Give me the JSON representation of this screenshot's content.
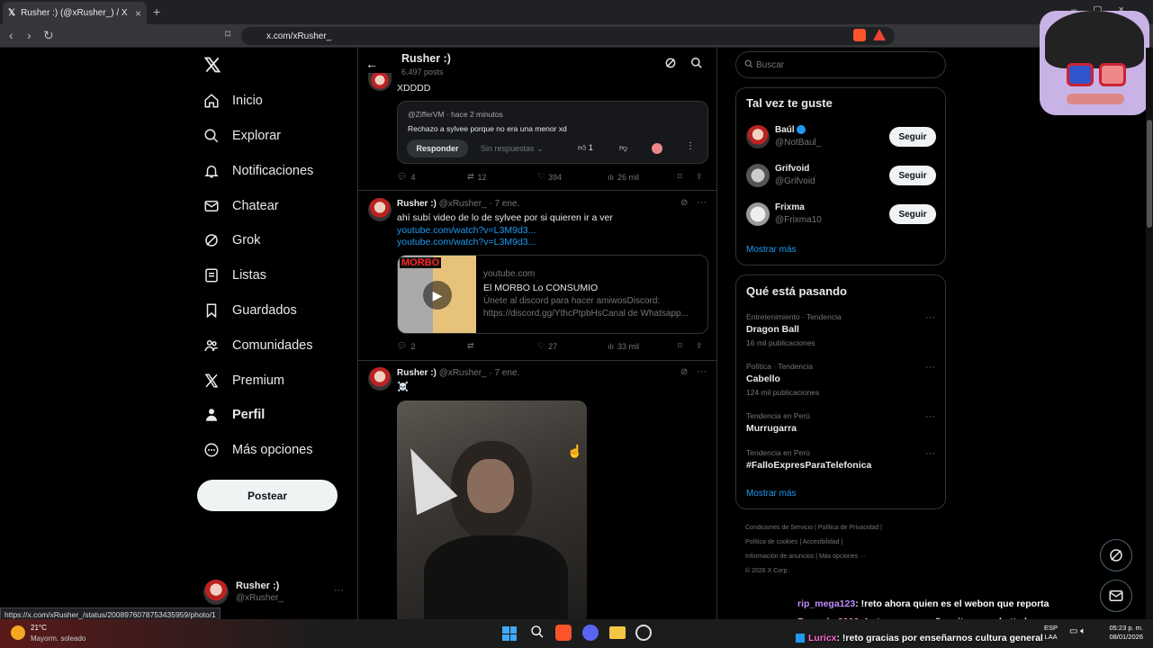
{
  "browser": {
    "tab_title": "Rusher :) (@xRusher_) / X",
    "url": "x.com/xRusher_",
    "status_url": "https://x.com/xRusher_/status/2008976078753435959/photo/1"
  },
  "nav": {
    "items": [
      "Inicio",
      "Explorar",
      "Notificaciones",
      "Chatear",
      "Grok",
      "Listas",
      "Guardados",
      "Comunidades",
      "Premium",
      "Perfil",
      "Más opciones"
    ],
    "post_button": "Postear",
    "account_name": "Rusher :)",
    "account_handle": "@xRusher_"
  },
  "header": {
    "name": "Rusher :)",
    "posts_count": "6.497 posts"
  },
  "post1": {
    "text": "XDDDD",
    "quote_user": "@ZifferVM",
    "quote_time": "hace 2 minutos",
    "quote_text": "Rechazo a sylvee porque no era una menor xd",
    "reply_btn": "Responder",
    "no_replies": "Sin respuestas",
    "likes_small": "1",
    "replies": "4",
    "reposts": "12",
    "likes": "394",
    "views": "26 mil"
  },
  "post2": {
    "name": "Rusher :)",
    "handle": "@xRusher_",
    "date": "· 7 ene.",
    "text": "ahí subí video de lo de sylvee por si quieren ir a ver",
    "link1": "youtube.com/watch?v=L3M9d3...",
    "link2": "youtube.com/watch?v=L3M9d3...",
    "card_domain": "youtube.com",
    "card_title": "El MORBO Lo CONSUMIO",
    "card_desc1": "Únete al discord para hacer amiwosDiscord:",
    "card_desc2": "https://discord.gg/YthcPtpbHsCanal de Whatsapp...",
    "thumb_text": "MORBO",
    "replies": "2",
    "reposts": "",
    "likes": "27",
    "views": "33 mil"
  },
  "post3": {
    "name": "Rusher :)",
    "handle": "@xRusher_",
    "date": "· 7 ene.",
    "text": "☠️"
  },
  "right": {
    "search_placeholder": "Buscar",
    "suggest_title": "Tal vez te guste",
    "suggestions": [
      {
        "name": "Baúl",
        "handle": "@NotBaul_",
        "btn": "Seguir"
      },
      {
        "name": "Grifvoid",
        "handle": "@Grifvoid",
        "btn": "Seguir"
      },
      {
        "name": "Frixma",
        "handle": "@Frixma10",
        "btn": "Seguir"
      }
    ],
    "show_more": "Mostrar más",
    "trends_title": "Qué está pasando",
    "trends": [
      {
        "cat": "Entretenimiento · Tendencia",
        "name": "Dragon Ball",
        "count": "16 mil publicaciones"
      },
      {
        "cat": "Política · Tendencia",
        "name": "Cabello",
        "count": "124 mil publicaciones"
      },
      {
        "cat": "Tendencia en Perú",
        "name": "Murrugarra",
        "count": ""
      },
      {
        "cat": "Tendencia en Perú",
        "name": "#FalloExpresParaTelefonica",
        "count": ""
      }
    ],
    "trends_more": "Mostrar más",
    "footer": [
      "Condiciones de Servicio",
      "Política de Privacidad",
      "Política de cookies",
      "Accesibilidad",
      "Información de anuncios",
      "Más opciones ···",
      "© 2026 X Corp."
    ]
  },
  "chat": [
    {
      "user": "rip_mega123",
      "msg": ": !reto ahora quien es el webon que reporta"
    },
    {
      "user": "Ronnyby2006",
      "msg": ": !reto es una muñequita como betty bu"
    },
    {
      "user": "Luricx",
      "msg": ": !reto gracias por enseñarnos cultura general"
    }
  ],
  "taskbar": {
    "temp": "21°C",
    "weather": "Mayorm. soleado",
    "lang1": "ESP",
    "lang2": "LAA",
    "time": "05:23 p. m.",
    "date": "08/01/2026"
  }
}
